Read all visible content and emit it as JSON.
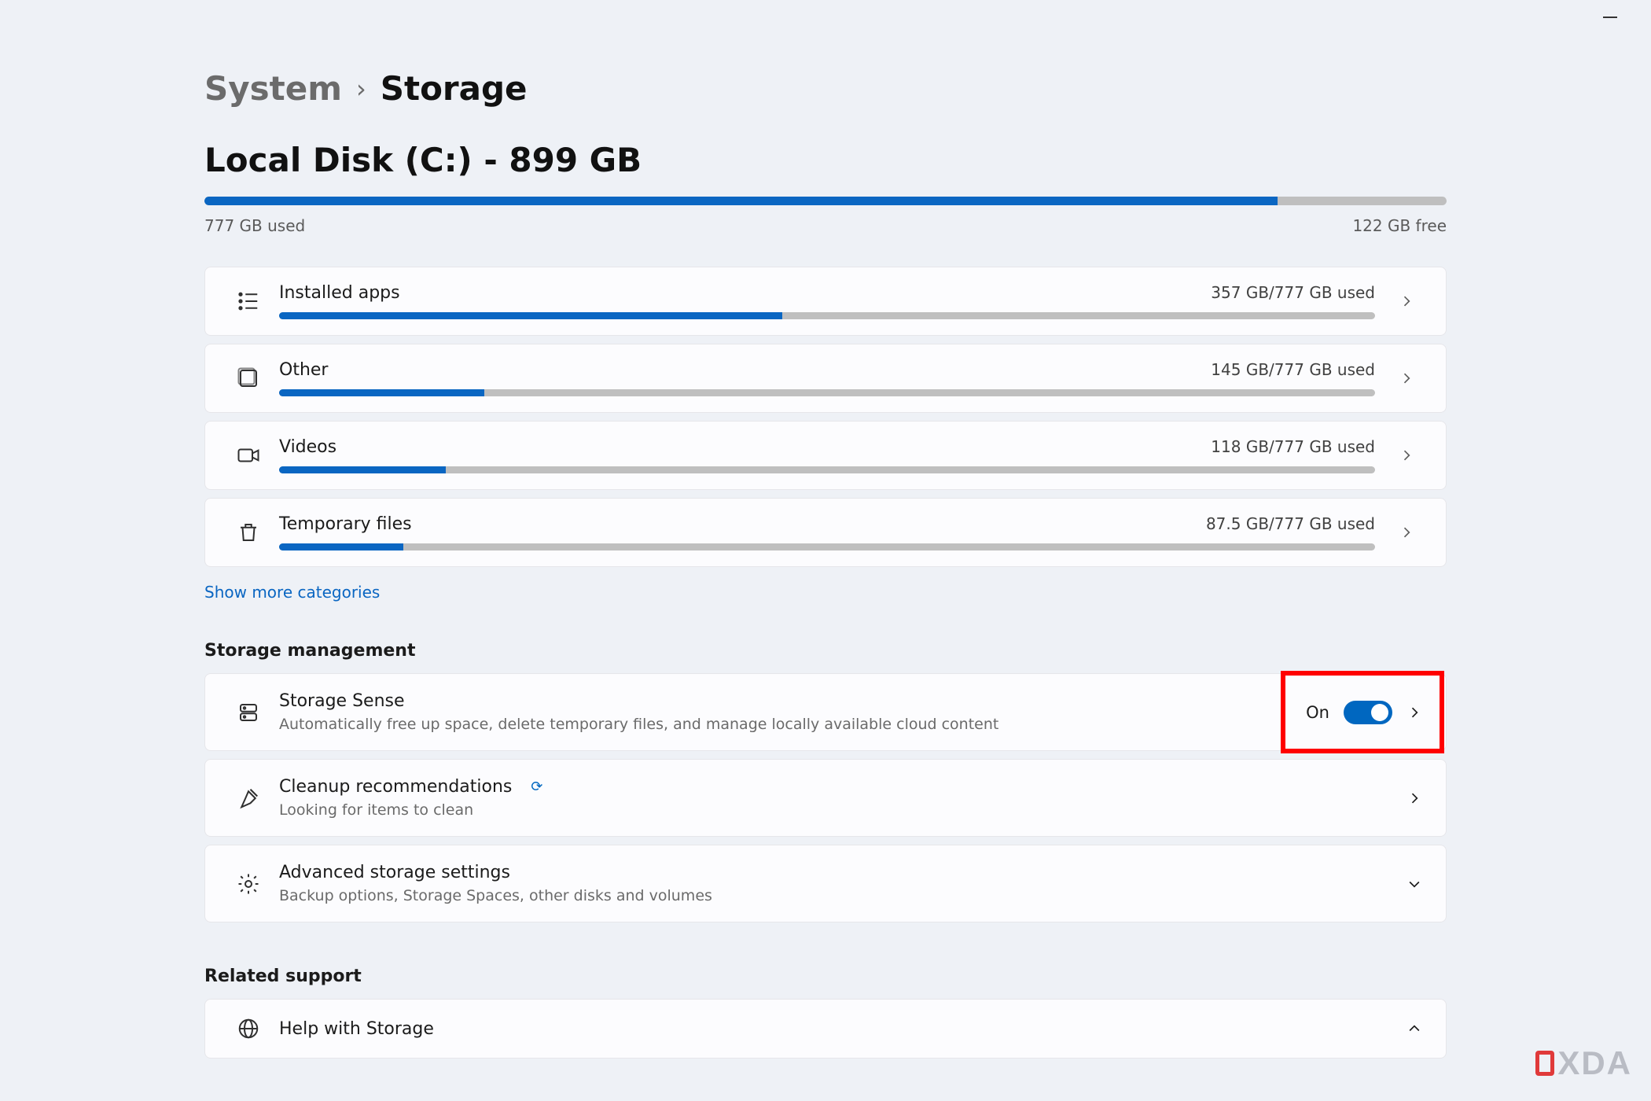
{
  "breadcrumb": {
    "parent": "System",
    "current": "Storage"
  },
  "disk": {
    "title": "Local Disk (C:) - 899 GB",
    "used_label": "777 GB used",
    "free_label": "122 GB free",
    "used_pct": 86.4
  },
  "categories": [
    {
      "icon": "apps-list",
      "title": "Installed apps",
      "usage": "357 GB/777 GB used",
      "pct": 45.9
    },
    {
      "icon": "box",
      "title": "Other",
      "usage": "145 GB/777 GB used",
      "pct": 18.7
    },
    {
      "icon": "video",
      "title": "Videos",
      "usage": "118 GB/777 GB used",
      "pct": 15.2
    },
    {
      "icon": "trash",
      "title": "Temporary files",
      "usage": "87.5 GB/777 GB used",
      "pct": 11.3
    }
  ],
  "show_more": "Show more categories",
  "sections": {
    "management_header": "Storage management",
    "related_header": "Related support"
  },
  "management": [
    {
      "icon": "drive",
      "title": "Storage Sense",
      "subtitle": "Automatically free up space, delete temporary files, and manage locally available cloud content",
      "toggle_label": "On",
      "has_toggle": true,
      "highlight": true,
      "chev": "right"
    },
    {
      "icon": "broom",
      "title": "Cleanup recommendations",
      "subtitle": "Looking for items to clean",
      "spinner": true,
      "chev": "right"
    },
    {
      "icon": "gear",
      "title": "Advanced storage settings",
      "subtitle": "Backup options, Storage Spaces, other disks and volumes",
      "chev": "down"
    }
  ],
  "related": [
    {
      "icon": "globe",
      "title": "Help with Storage",
      "chev": "up"
    }
  ],
  "watermark": "XDA"
}
